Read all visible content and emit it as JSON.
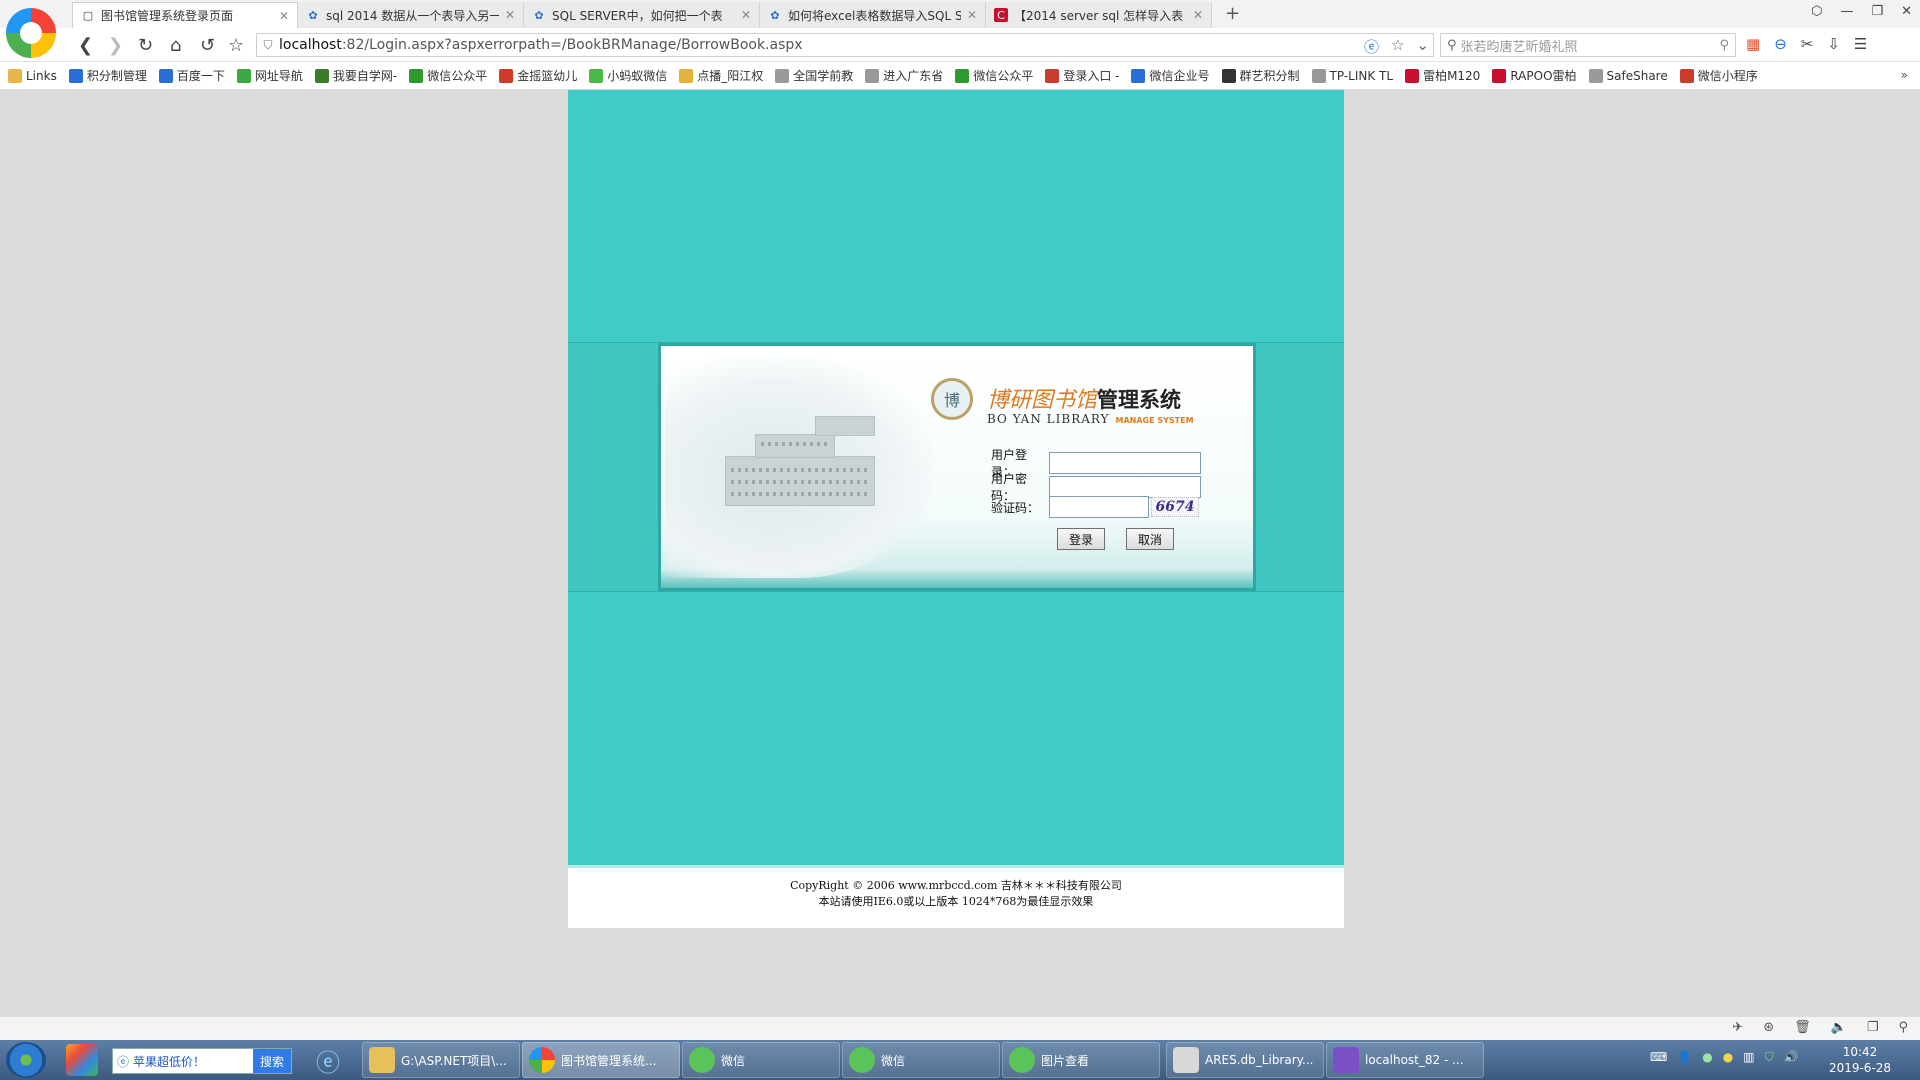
{
  "browser": {
    "tabs": [
      {
        "label": "图书馆管理系统登录页面",
        "icon": "page-icon",
        "active": true
      },
      {
        "label": "sql 2014 数据从一个表导入另一",
        "icon": "baidu-paw-icon",
        "active": false
      },
      {
        "label": "SQL SERVER中，如何把一个表",
        "icon": "baidu-paw-icon",
        "active": false
      },
      {
        "label": "如何将excel表格数据导入SQL S",
        "icon": "baidu-paw-icon",
        "active": false
      },
      {
        "label": "【2014 server sql 怎样导入表",
        "icon": "csdn-icon",
        "active": false
      }
    ],
    "new_tab": "+",
    "address": {
      "host": "localhost",
      "rest": ":82/Login.aspx?aspxerrorpath=/BookBRManage/BorrowBook.aspx"
    },
    "search_placeholder": "张若昀唐艺昕婚礼照",
    "bookmarks": [
      {
        "label": "Links",
        "color": "#e8b64a"
      },
      {
        "label": "积分制管理",
        "color": "#2a6fd6"
      },
      {
        "label": "百度一下",
        "color": "#2a6fd6"
      },
      {
        "label": "网址导航",
        "color": "#3aa845"
      },
      {
        "label": "我要自学网-",
        "color": "#3b7a2b"
      },
      {
        "label": "微信公众平",
        "color": "#2f9b2f"
      },
      {
        "label": "金摇篮幼儿",
        "color": "#d23a2a"
      },
      {
        "label": "小蚂蚁微信",
        "color": "#49b949"
      },
      {
        "label": "点播_阳江权",
        "color": "#e2b43b"
      },
      {
        "label": "全国学前教",
        "color": "#999999"
      },
      {
        "label": "进入广东省",
        "color": "#999999"
      },
      {
        "label": "微信公众平",
        "color": "#2f9b2f"
      },
      {
        "label": "登录入口 -",
        "color": "#c93b2b"
      },
      {
        "label": "微信企业号",
        "color": "#2a6fd6"
      },
      {
        "label": "群艺积分制",
        "color": "#333333"
      },
      {
        "label": "TP-LINK TL",
        "color": "#999999"
      },
      {
        "label": "雷柏M120",
        "color": "#c8102e"
      },
      {
        "label": "RAPOO雷柏",
        "color": "#c8102e"
      },
      {
        "label": "SafeShare",
        "color": "#999999"
      },
      {
        "label": "微信小程序",
        "color": "#c93b2b"
      }
    ],
    "bookmarks_more": "»"
  },
  "login": {
    "brand_seal": "博",
    "brand_title_art": "博研图书馆",
    "brand_title_main": "管理系统",
    "brand_sub": "BO YAN LIBRARY",
    "brand_sub_accent": "MANAGE SYSTEM",
    "user_label": "用户登录：",
    "user_value": "",
    "pass_label": "用户密码：",
    "pass_value": "",
    "code_label": "验证码：",
    "code_value": "",
    "captcha_text": "6674",
    "login_button": "登录",
    "cancel_button": "取消"
  },
  "footer": {
    "line1": "CopyRight © 2006 www.mrbccd.com 吉林＊＊＊科技有限公司",
    "line2": "本站请使用IE6.0或以上版本 1024*768为最佳显示效果"
  },
  "taskbar": {
    "search_text": "苹果超低价！",
    "search_button": "搜索",
    "tasks": [
      {
        "label": "G:\\ASP.NET项目\\...",
        "icon_color": "#e6c15a",
        "active": false
      },
      {
        "label": "图书馆管理系统...",
        "icon_color": "#e94f3a",
        "active": true
      },
      {
        "label": "微信",
        "icon_color": "#5ac35a",
        "active": false
      },
      {
        "label": "微信",
        "icon_color": "#5ac35a",
        "active": false
      },
      {
        "label": "图片查看",
        "icon_color": "#5ac35a",
        "active": false
      },
      {
        "label": "ARES.db_Library...",
        "icon_color": "#d8d8d8",
        "active": false
      },
      {
        "label": "localhost_82 - ...",
        "icon_color": "#7b4fc7",
        "active": false
      }
    ],
    "clock_time": "10:42",
    "clock_date": "2019-6-28"
  }
}
